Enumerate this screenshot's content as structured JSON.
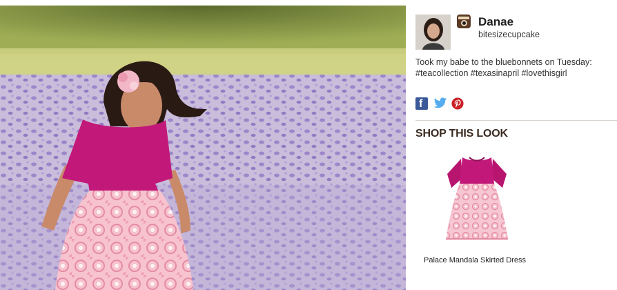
{
  "post": {
    "user_name": "Danae",
    "user_handle": "bitesizecupcake",
    "caption_lines": [
      "Took my babe to the bluebonnets on Tuesday:",
      "#teacollection #texasinapril #lovethisgirl"
    ]
  },
  "icons": {
    "instagram": "instagram-icon",
    "facebook": "facebook-icon",
    "twitter": "twitter-icon",
    "pinterest": "pinterest-icon"
  },
  "colors": {
    "facebook": "#3b5998",
    "twitter": "#55acee",
    "pinterest": "#cb2027",
    "dress_top": "#c2187a",
    "dress_skirt": "#f3b9c8"
  },
  "shop": {
    "title": "SHOP THIS LOOK",
    "products": [
      {
        "name": "Palace Mandala Skirted Dress"
      }
    ]
  }
}
